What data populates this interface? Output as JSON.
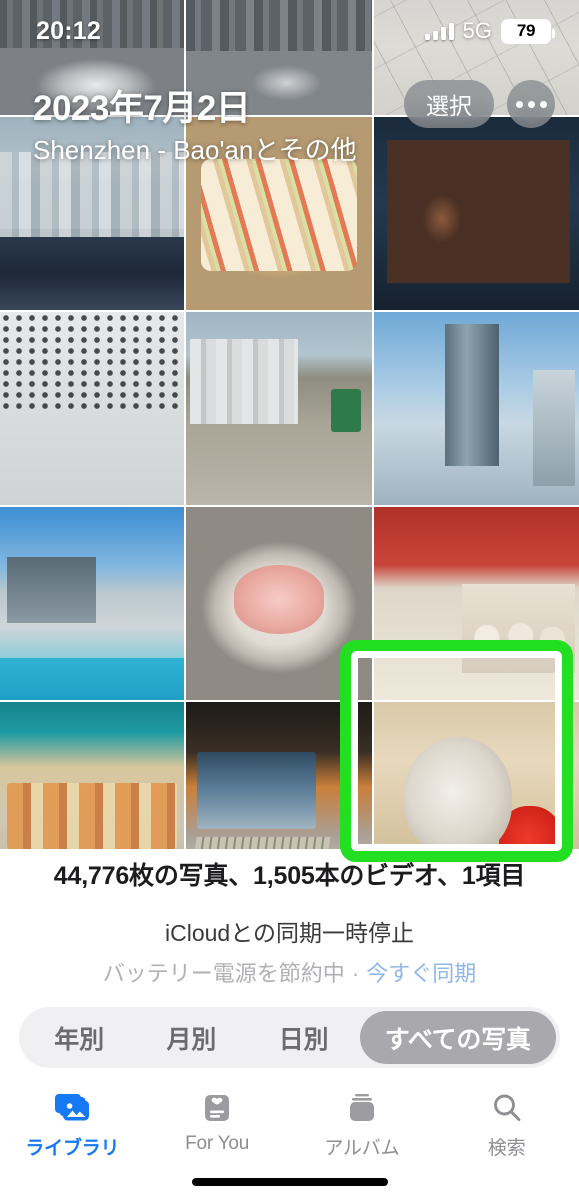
{
  "status_bar": {
    "time": "20:12",
    "network": "5G",
    "battery_level": "79",
    "signal_icon": "cellular-bars-icon",
    "battery_icon": "battery-icon"
  },
  "header": {
    "date_title": "2023年7月2日",
    "location_subtitle": "Shenzhen - Bao'anとその他",
    "select_label": "選択",
    "more_icon": "ellipsis-icon"
  },
  "grid": {
    "columns": 3,
    "photos": [
      {
        "name": "photo-traffic-cars",
        "art": "p-traffic1",
        "row": 0
      },
      {
        "name": "photo-traffic-road",
        "art": "p-traffic2",
        "row": 0
      },
      {
        "name": "photo-map-screenshot",
        "art": "p-map",
        "row": 0
      },
      {
        "name": "photo-city-car",
        "art": "p-city",
        "row": 1
      },
      {
        "name": "photo-sandwich-plate",
        "art": "p-sandwich",
        "row": 1
      },
      {
        "name": "photo-movie-poster",
        "art": "p-poster",
        "row": 1
      },
      {
        "name": "photo-station-ceiling",
        "art": "p-ceiling",
        "row": 2
      },
      {
        "name": "photo-street-view",
        "art": "p-street",
        "row": 2
      },
      {
        "name": "photo-tower-construction",
        "art": "p-tower",
        "row": 2
      },
      {
        "name": "photo-plaza-pool",
        "art": "p-plaza",
        "row": 3
      },
      {
        "name": "photo-sashimi-dish",
        "art": "p-sashimi",
        "row": 3
      },
      {
        "name": "photo-dumpling-package",
        "art": "p-dumpling",
        "row": 3
      },
      {
        "name": "photo-mall-interior",
        "art": "p-mall",
        "row": 4
      },
      {
        "name": "photo-laptop-cafe",
        "art": "p-laptop",
        "row": 4
      },
      {
        "name": "photo-hamster-strawberry",
        "art": "p-hamster",
        "row": 4
      }
    ],
    "highlight": {
      "target_photo": "photo-hamster-strawberry",
      "color": "#22df22"
    }
  },
  "info": {
    "photo_count": "44,776枚の写真、1,505本のビデオ、1項目",
    "sync_status": "iCloudとの同期一時停止",
    "sync_detail_prefix": "バッテリー電源を節約中",
    "sync_detail_separator": " · ",
    "sync_now_label": "今すぐ同期",
    "link_color": "#8fb8e8"
  },
  "segmented_control": {
    "options": [
      {
        "label": "年別",
        "selected": false
      },
      {
        "label": "月別",
        "selected": false
      },
      {
        "label": "日別",
        "selected": false
      },
      {
        "label": "すべての写真",
        "selected": true
      }
    ],
    "selected_bg": "#a8a8ad"
  },
  "tab_bar": {
    "accent_color": "#1678f2",
    "inactive_color": "#8e8e93",
    "tabs": [
      {
        "label": "ライブラリ",
        "icon": "photo-stack-icon",
        "active": true
      },
      {
        "label": "For You",
        "icon": "for-you-card-icon",
        "active": false
      },
      {
        "label": "アルバム",
        "icon": "albums-stack-icon",
        "active": false
      },
      {
        "label": "検索",
        "icon": "search-icon",
        "active": false
      }
    ]
  }
}
